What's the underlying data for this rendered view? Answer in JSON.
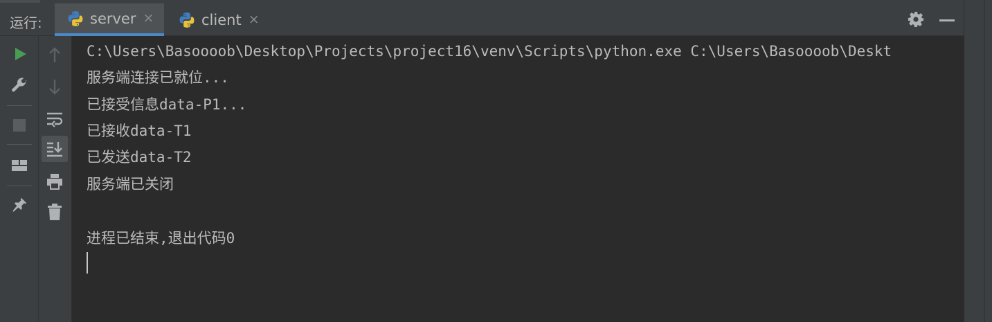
{
  "toolwindow": {
    "run_label": "运行:",
    "tabs": [
      {
        "label": "server",
        "icon": "python-icon",
        "active": true
      },
      {
        "label": "client",
        "icon": "python-icon",
        "active": false
      }
    ],
    "close_glyph": "×",
    "actions": [
      "gear-icon",
      "minimize-icon"
    ]
  },
  "left_toolbar": {
    "column1": [
      "rerun-icon",
      "wrench-icon",
      "stop-icon",
      "layout-icon",
      "pin-icon"
    ],
    "column2": [
      "up-arrow-icon",
      "down-arrow-icon",
      "soft-wrap-icon",
      "scroll-to-end-icon",
      "print-icon",
      "trash-icon"
    ]
  },
  "console": {
    "lines": [
      "C:\\Users\\Basoooob\\Desktop\\Projects\\project16\\venv\\Scripts\\python.exe C:\\Users\\Basoooob\\Deskt",
      "服务端连接已就位...",
      "已接受信息data-P1...",
      "已接收data-T1",
      "已发送data-T2",
      "服务端已关闭",
      "",
      "进程已结束,退出代码0"
    ]
  },
  "colors": {
    "panel": "#3c3f41",
    "console_bg": "#2b2b2b",
    "text": "#bbbbbb",
    "accent": "#4a88c7",
    "run_green": "#499c54"
  }
}
